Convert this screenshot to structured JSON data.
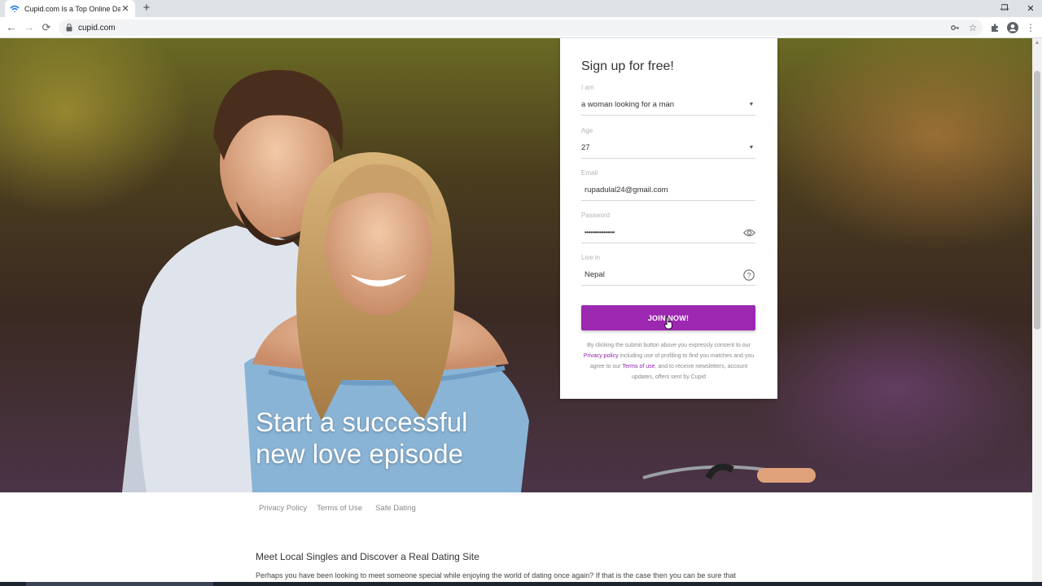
{
  "browser": {
    "tab_title": "Cupid.com Is a Top Online Dating",
    "new_tab_symbol": "+",
    "url": "cupid.com"
  },
  "hero": {
    "heading_line1": "Start a successful",
    "heading_line2": "new love episode"
  },
  "signup": {
    "title": "Sign up for free!",
    "fields": {
      "i_am": {
        "label": "I am",
        "value": "a woman looking for a man"
      },
      "age": {
        "label": "Age",
        "value": "27"
      },
      "email": {
        "label": "Email",
        "value": "rupadulal24@gmail.com"
      },
      "password": {
        "label": "Password",
        "value": "••••••••••••••••"
      },
      "live_in": {
        "label": "Live in",
        "value": "Nepal"
      }
    },
    "join_button": "JOIN NOW!",
    "consent": {
      "part1": "By clicking the submit button above you expressly consent to our ",
      "privacy_link": "Privacy policy",
      "part2": " including use of profiling to find you matches and you agree to our ",
      "terms_link": "Terms of use",
      "part3": ", and to receive newsletters, account updates, offers sent by Cupid"
    },
    "accent_color": "#9c27b0"
  },
  "footer": {
    "links": [
      "Privacy Policy",
      "Terms of Use",
      "Safe Dating"
    ],
    "seo_title": "Meet Local Singles and Discover a Real Dating Site",
    "seo_text": "Perhaps you have been looking to meet someone special while enjoying the world of dating once again? If that is the case then you can be sure that"
  }
}
